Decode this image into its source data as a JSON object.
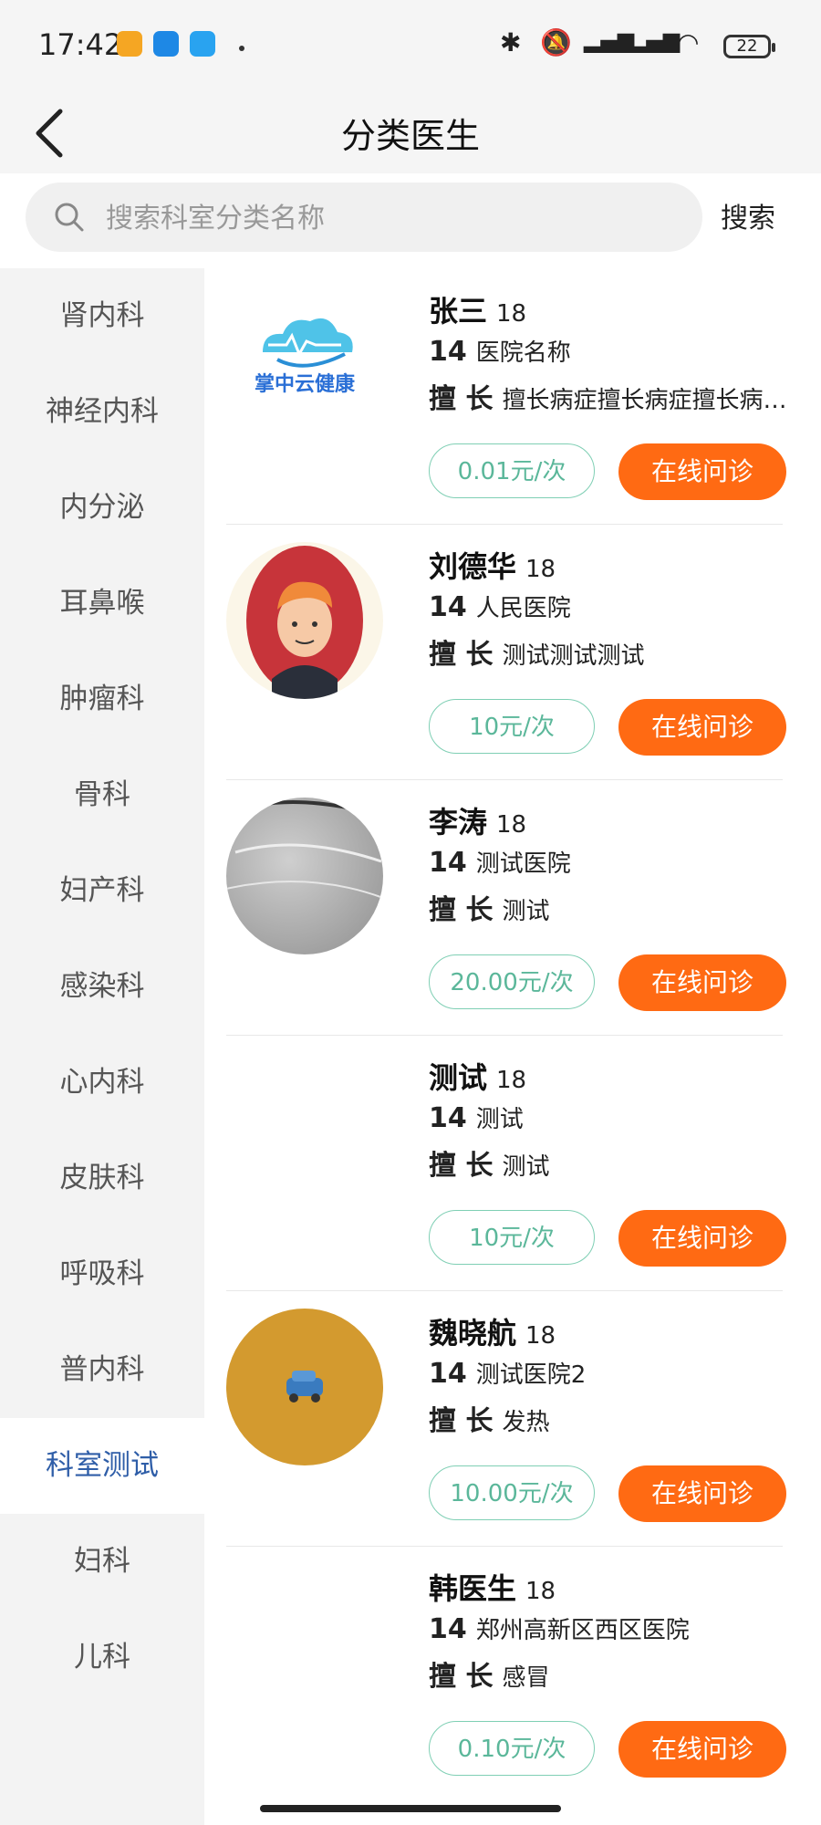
{
  "status_bar": {
    "time": "17:42",
    "battery": "22"
  },
  "header": {
    "title": "分类医生"
  },
  "search": {
    "placeholder": "搜索科室分类名称",
    "button_label": "搜索"
  },
  "categories": [
    {
      "label": "肾内科"
    },
    {
      "label": "神经内科"
    },
    {
      "label": "内分泌"
    },
    {
      "label": "耳鼻喉"
    },
    {
      "label": "肿瘤科"
    },
    {
      "label": "骨科"
    },
    {
      "label": "妇产科"
    },
    {
      "label": "感染科"
    },
    {
      "label": "心内科"
    },
    {
      "label": "皮肤科"
    },
    {
      "label": "呼吸科"
    },
    {
      "label": "普内科"
    },
    {
      "label": "科室测试",
      "active": true
    },
    {
      "label": "妇科"
    },
    {
      "label": "儿科"
    }
  ],
  "labels": {
    "specialty": "擅 长"
  },
  "doctors": [
    {
      "name": "张三",
      "age": "18",
      "level": "14",
      "hospital": "医院名称",
      "specialty": "擅长病症擅长病症擅长病症擅长病症",
      "price": "0.01元/次",
      "action": "在线问诊",
      "avatar": "logo-cloud",
      "logo_text": "掌中云健康"
    },
    {
      "name": "刘德华",
      "age": "18",
      "level": "14",
      "hospital": "人民医院",
      "specialty": "测试测试测试",
      "price": "10元/次",
      "action": "在线问诊",
      "avatar": "cartoon-man"
    },
    {
      "name": "李涛",
      "age": "18",
      "level": "14",
      "hospital": "测试医院",
      "specialty": "测试",
      "price": "20.00元/次",
      "action": "在线问诊",
      "avatar": "gray-photo"
    },
    {
      "name": "测试",
      "age": "18",
      "level": "14",
      "hospital": "测试",
      "specialty": "测试",
      "price": "10元/次",
      "action": "在线问诊",
      "avatar": "none"
    },
    {
      "name": "魏晓航",
      "age": "18",
      "level": "14",
      "hospital": "测试医院2",
      "specialty": "发热",
      "price": "10.00元/次",
      "action": "在线问诊",
      "avatar": "car-on-gold"
    },
    {
      "name": "韩医生",
      "age": "18",
      "level": "14",
      "hospital": "郑州高新区西区医院",
      "specialty": "感冒",
      "price": "0.10元/次",
      "action": "在线问诊",
      "avatar": "none"
    }
  ],
  "colors": {
    "accent": "#ff6a13",
    "price_text": "#5bb79a",
    "active_category": "#2f5ea8"
  }
}
